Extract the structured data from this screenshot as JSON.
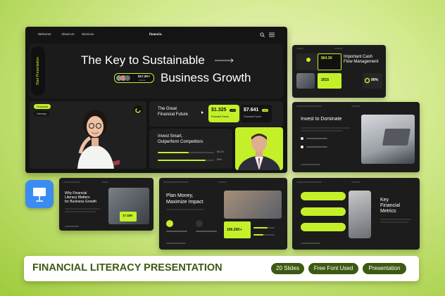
{
  "main": {
    "nav": {
      "welcome": "Welcome",
      "about": "About Us",
      "services": "Services",
      "brand": "financio."
    },
    "vertical_label": "Start Presentation",
    "headline_line1": "The Key to Sustainable",
    "headline_line2": "Business Growth",
    "badge_value": "$17.2K+",
    "badge_sub": "Clients",
    "tags": [
      "Financial",
      "Literacy"
    ],
    "card1_title_line1": "The Great",
    "card1_title_line2": "Financial Future",
    "stat1_value": "$1.325",
    "stat1_badge": "+2%",
    "stat1_label": "Financial Future",
    "stat2_value": "$7.641",
    "stat2_badge": "+2%",
    "stat2_label": "Financial Future",
    "card2_line1": "Invest Smart,",
    "card2_line2": "Outperform Competitors",
    "progress1_label": "55.1%",
    "progress1_value": 0.55,
    "progress2_label": "85%",
    "progress2_value": 0.85
  },
  "thumb_cash": {
    "title_line1": "Important Cash",
    "title_line2": "Flow Management",
    "value1": "$64.3K",
    "value2": "2015",
    "value3": "90%"
  },
  "thumb_invest": {
    "title": "Invest to Dominate"
  },
  "thumb_why": {
    "title_line1": "Why Financial",
    "title_line2": "Literacy Matters",
    "title_line3": "for Business Growth",
    "value": "17.329"
  },
  "thumb_plan": {
    "title_line1": "Plan Money,",
    "title_line2": "Maximize Impact",
    "value": "106.25K+"
  },
  "thumb_metrics": {
    "title_line1": "Key",
    "title_line2": "Financial",
    "title_line3": "Metrics"
  },
  "footer": {
    "title": "FINANCIAL LITERACY PRESENTATION",
    "tags": [
      "20 Slides",
      "Free Font Used",
      "Presentation"
    ]
  },
  "colors": {
    "accent": "#c4f02a",
    "dark": "#141414",
    "tag": "#3d5a12",
    "keynote": "#3b8cf0"
  }
}
